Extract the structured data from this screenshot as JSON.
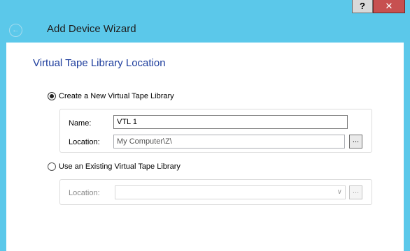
{
  "window": {
    "title": "Add Device Wizard",
    "help_label": "?",
    "close_label": "✕",
    "back_icon": "back-arrow-icon"
  },
  "page": {
    "section_title": "Virtual Tape Library Location"
  },
  "create_option": {
    "label": "Create a New Virtual Tape Library",
    "selected": true,
    "name_label": "Name:",
    "name_value": "VTL 1",
    "location_label": "Location:",
    "location_value": "My Computer\\Z\\",
    "browse_label": "..."
  },
  "existing_option": {
    "label": "Use an Existing Virtual Tape Library",
    "selected": false,
    "location_label": "Location:",
    "location_value": "",
    "browse_label": "..."
  },
  "colors": {
    "titlebar": "#5bc8ea",
    "close": "#c75050",
    "section_title": "#1c3c9c"
  }
}
